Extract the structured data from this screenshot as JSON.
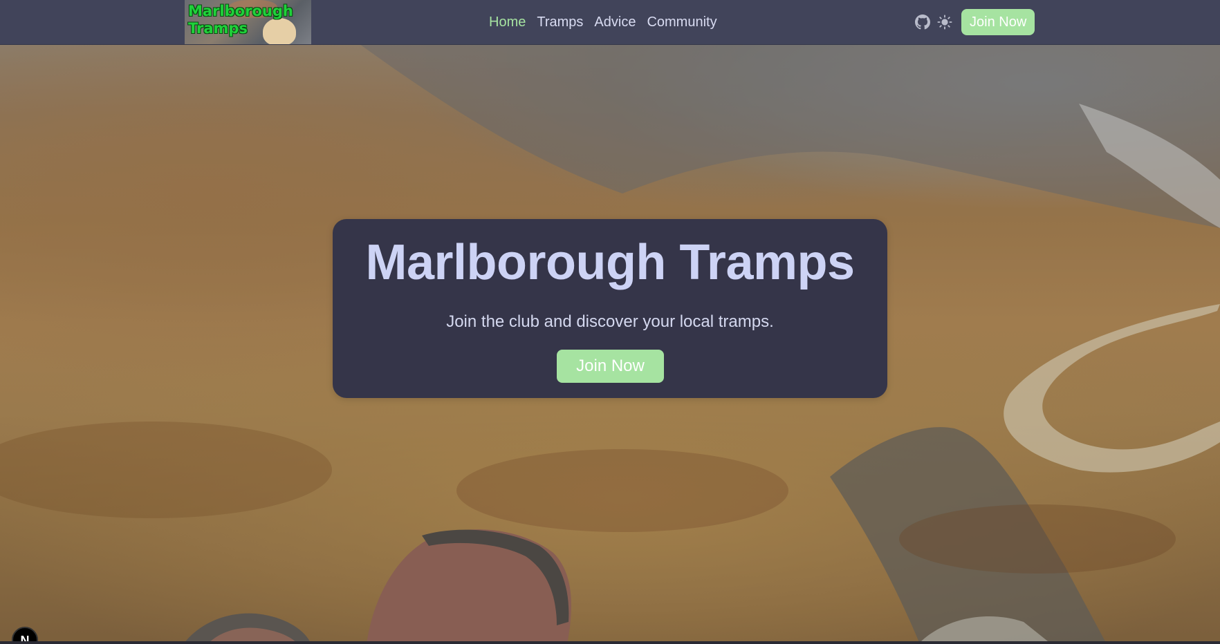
{
  "navbar": {
    "logo": {
      "text": "Marlborough\nTramps",
      "icon": "site-logo"
    },
    "links": [
      {
        "label": "Home",
        "active": true
      },
      {
        "label": "Tramps",
        "active": false
      },
      {
        "label": "Advice",
        "active": false
      },
      {
        "label": "Community",
        "active": false
      }
    ],
    "icons": [
      "github-icon",
      "sun-icon"
    ],
    "join_label": "Join Now"
  },
  "hero": {
    "title": "Marlborough Tramps",
    "subtitle": "Join the club and discover your local tramps.",
    "join_label": "Join Now"
  },
  "dev_badge": {
    "label": "N"
  },
  "colors": {
    "navbar_bg": "#41445a",
    "accent_green": "#a6e3a1",
    "card_bg": "#353549",
    "title_text": "#cdd3f5",
    "nav_text": "#d9dcf2"
  }
}
